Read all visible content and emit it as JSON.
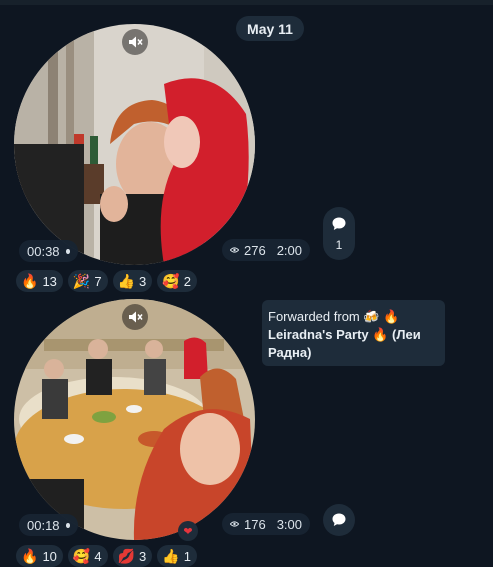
{
  "date_separator": "May 11",
  "messages": [
    {
      "duration": "00:38",
      "views": "276",
      "time": "2:00",
      "comments_count": "1",
      "reactions": [
        {
          "emoji": "🔥",
          "count": "13"
        },
        {
          "emoji": "🎉",
          "count": "7"
        },
        {
          "emoji": "👍",
          "count": "3"
        },
        {
          "emoji": "🥰",
          "count": "2"
        }
      ]
    },
    {
      "forwarded_prefix": "Forwarded from",
      "forwarded_source": "🍻 🔥 Leiradna's Party 🔥 (Леи Радна)",
      "duration": "00:18",
      "views": "176",
      "time": "3:00",
      "own_reaction": "❤",
      "reactions": [
        {
          "emoji": "🔥",
          "count": "10"
        },
        {
          "emoji": "🥰",
          "count": "4"
        },
        {
          "emoji": "💋",
          "count": "3"
        },
        {
          "emoji": "👍",
          "count": "1"
        }
      ]
    }
  ],
  "colors": {
    "background": "#0e1621",
    "pill": "#1e2c3a",
    "text": "#e8eef3",
    "heart": "#e5343d"
  },
  "icons": [
    "mute-icon",
    "eye-icon",
    "comment-icon",
    "heart-icon"
  ]
}
